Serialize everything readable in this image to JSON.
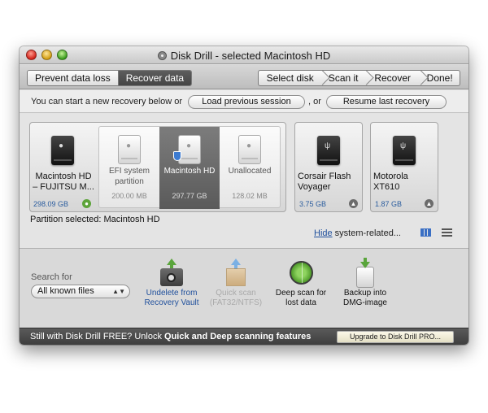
{
  "window": {
    "title": "Disk Drill - selected Macintosh HD"
  },
  "toolbar": {
    "modes": [
      "Prevent data loss",
      "Recover data"
    ],
    "steps": [
      "Select disk",
      "Scan it",
      "Recover",
      "Done!"
    ]
  },
  "infobar": {
    "text_before": "You can start a new recovery below or",
    "load_session": "Load previous session",
    "or": ", or",
    "resume": "Resume last recovery"
  },
  "drives": {
    "main": {
      "name": "Macintosh HD – FUJITSU M...",
      "size": "298.09 GB"
    },
    "partitions": [
      {
        "name": "EFI system partition",
        "size": "200.00 MB"
      },
      {
        "name": "Macintosh HD",
        "size": "297.77 GB"
      },
      {
        "name": "Unallocated",
        "size": "128.02 MB"
      }
    ],
    "corsair": {
      "name": "Corsair Flash Voyager",
      "size": "3.75 GB"
    },
    "motorola": {
      "name": "Motorola XT610",
      "size": "1.87 GB"
    }
  },
  "partition_selected": "Partition selected: Macintosh HD",
  "system_related": {
    "link": "Hide",
    "rest": " system-related..."
  },
  "search": {
    "label": "Search for",
    "selected": "All known files"
  },
  "actions": {
    "undelete": "Undelete from Recovery Vault",
    "quick": "Quick scan (FAT32/NTFS)",
    "deep": "Deep scan for lost data",
    "backup": "Backup into DMG-image"
  },
  "footer": {
    "text_plain": "Still with Disk Drill FREE? Unlock ",
    "text_bold": "Quick and Deep scanning features",
    "upgrade": "Upgrade to Disk Drill PRO..."
  }
}
